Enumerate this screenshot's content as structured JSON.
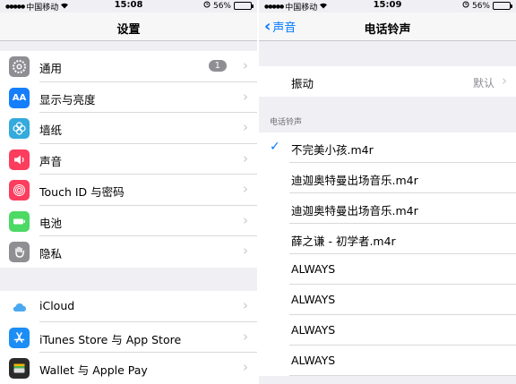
{
  "left": {
    "status": {
      "carrier": "中国移动",
      "time": "15:08",
      "battery": "56%"
    },
    "nav_title": "设置",
    "group1": [
      {
        "label": "通用",
        "icon": "gear-icon",
        "color": "#8e8e93",
        "badge": "1"
      },
      {
        "label": "显示与亮度",
        "icon": "display-icon",
        "color": "#157efb"
      },
      {
        "label": "墙纸",
        "icon": "wallpaper-flower-icon",
        "color": "#35aadc"
      },
      {
        "label": "声音",
        "icon": "speaker-icon",
        "color": "#fc3d5e"
      },
      {
        "label": "Touch ID 与密码",
        "icon": "fingerprint-icon",
        "color": "#fc3d5e"
      },
      {
        "label": "电池",
        "icon": "battery-icon",
        "color": "#4cd964"
      },
      {
        "label": "隐私",
        "icon": "hand-icon",
        "color": "#8e8e93"
      }
    ],
    "group2": [
      {
        "label": "iCloud",
        "icon": "cloud-icon",
        "color": "#ffffff"
      },
      {
        "label": "iTunes Store 与 App Store",
        "icon": "app-store-icon",
        "color": "#1c8df5"
      },
      {
        "label": "Wallet 与 Apple Pay",
        "icon": "wallet-icon",
        "color": "#2b2b2b"
      }
    ]
  },
  "right": {
    "status": {
      "carrier": "中国移动",
      "time": "15:09",
      "battery": "56%"
    },
    "back_label": "声音",
    "nav_title": "电话铃声",
    "vibration": {
      "label": "振动",
      "value": "默认"
    },
    "section_header": "电话铃声",
    "ringtones": [
      {
        "label": "不完美小孩.m4r",
        "checked": true
      },
      {
        "label": "迪迦奥特曼出场音乐.m4r"
      },
      {
        "label": "迪迦奥特曼出场音乐.m4r"
      },
      {
        "label": "薛之谦 - 初学者.m4r"
      },
      {
        "label": "ALWAYS"
      },
      {
        "label": "ALWAYS"
      },
      {
        "label": "ALWAYS"
      },
      {
        "label": "ALWAYS"
      }
    ]
  }
}
